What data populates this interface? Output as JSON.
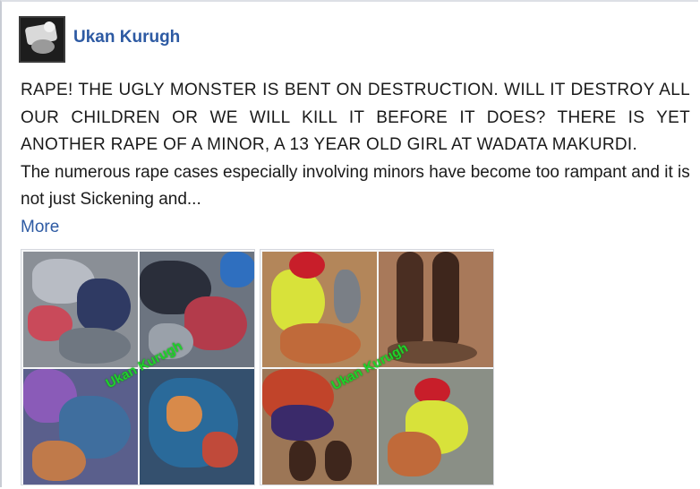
{
  "post": {
    "author": "Ukan Kurugh",
    "paragraph_caps": "RAPE! THE UGLY MONSTER IS BENT ON DESTRUCTION. WILL IT DESTROY ALL OUR CHILDREN OR WE WILL KILL IT BEFORE IT DOES? THERE IS YET ANOTHER RAPE OF A MINOR, A 13 YEAR OLD GIRL AT WADATA MAKURDI.",
    "paragraph_body": "The numerous rape cases especially involving minors have become too rampant and it is not just Sickening and...",
    "more_label": "More",
    "photos": [
      {
        "watermark": "Ukan Kurugh",
        "icon": "photo-collage-clothes"
      },
      {
        "watermark": "Ukan Kurugh",
        "icon": "photo-collage-girl"
      }
    ]
  },
  "colors": {
    "author": "#2d5aa3",
    "link": "#2d5aa3",
    "text": "#1a1a1a",
    "watermark": "#1fd12b"
  }
}
